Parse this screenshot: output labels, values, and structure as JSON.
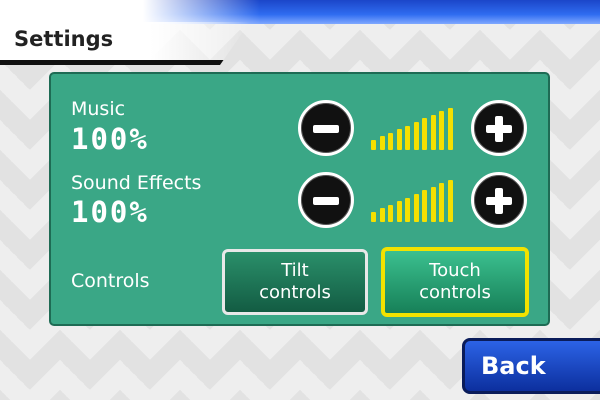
{
  "header": {
    "title": "Settings"
  },
  "music": {
    "label": "Music",
    "value": "100%",
    "level": 1.0
  },
  "sound_effects": {
    "label": "Sound Effects",
    "value": "100%",
    "level": 1.0
  },
  "controls": {
    "label": "Controls",
    "tilt_line1": "Tilt",
    "tilt_line2": "controls",
    "touch_line1": "Touch",
    "touch_line2": "controls",
    "selected": "touch"
  },
  "footer": {
    "back_label": "Back"
  },
  "icons": {
    "decrease": "minus-icon",
    "increase": "plus-icon"
  },
  "colors": {
    "panel": "#3aa786",
    "volume_bar": "#f5e000",
    "selected_outline": "#f2e200",
    "back_button": "#2c63e6"
  }
}
